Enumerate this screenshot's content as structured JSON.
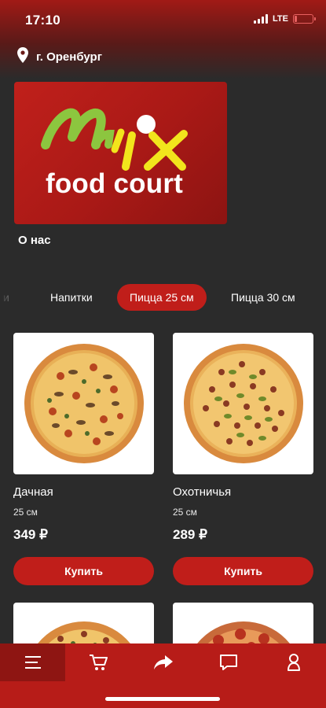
{
  "status_bar": {
    "time": "17:10",
    "network": "LTE",
    "battery_level": 0.15
  },
  "location": {
    "icon": "map-pin-icon",
    "city": "г. Оренбург"
  },
  "promo": {
    "logo_word": "Mix",
    "logo_subtitle": "food court",
    "label": "О нас"
  },
  "categories": {
    "items": [
      {
        "label": "и"
      },
      {
        "label": "Напитки"
      },
      {
        "label": "Пицца 25 см"
      },
      {
        "label": "Пицца 30 см"
      }
    ],
    "active_index": 2
  },
  "products": [
    {
      "name": "Дачная",
      "size": "25 см",
      "price": "349 ₽",
      "button": "Купить"
    },
    {
      "name": "Охотничья",
      "size": "25 см",
      "price": "289 ₽",
      "button": "Купить"
    }
  ],
  "bottom_nav": {
    "items": [
      {
        "icon": "menu-icon"
      },
      {
        "icon": "cart-icon"
      },
      {
        "icon": "share-icon"
      },
      {
        "icon": "chat-icon"
      },
      {
        "icon": "profile-icon"
      }
    ],
    "active_index": 0
  },
  "colors": {
    "accent": "#c01e1a",
    "background": "#2b2b2b",
    "nav_background": "#b71c18",
    "logo_green": "#8cc63f",
    "logo_yellow": "#f2e51c"
  }
}
